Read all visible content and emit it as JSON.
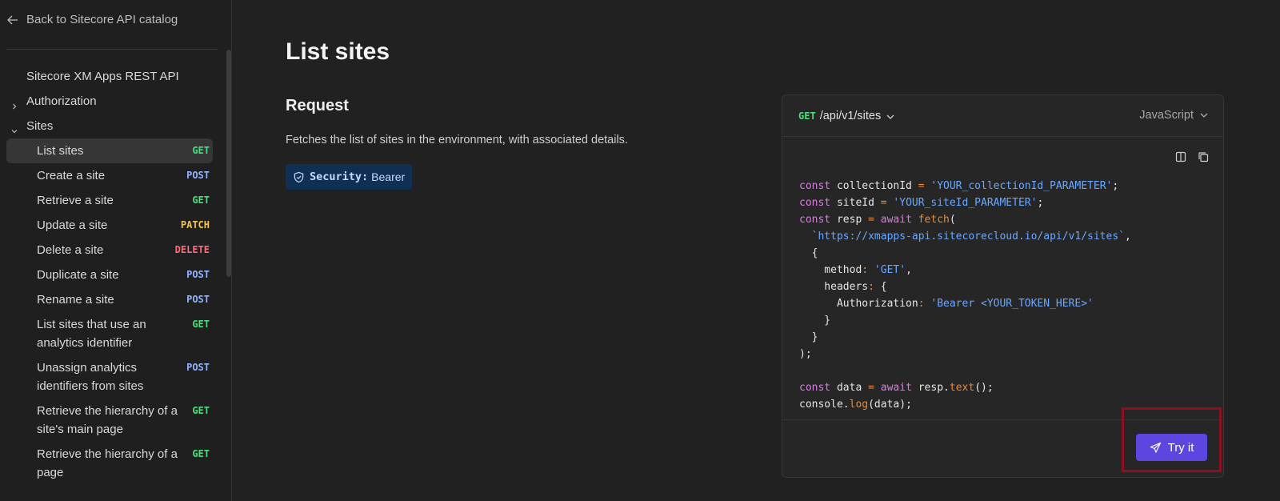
{
  "sidebar": {
    "back_label": "Back to Sitecore API catalog",
    "items": [
      {
        "label": "Sitecore XM Apps REST API",
        "level": 0,
        "expander": "none"
      },
      {
        "label": "Authorization",
        "level": 0,
        "expander": "collapsed"
      },
      {
        "label": "Sites",
        "level": 0,
        "expander": "expanded"
      },
      {
        "label": "List sites",
        "level": 1,
        "method": "GET",
        "active": true
      },
      {
        "label": "Create a site",
        "level": 1,
        "method": "POST"
      },
      {
        "label": "Retrieve a site",
        "level": 1,
        "method": "GET"
      },
      {
        "label": "Update a site",
        "level": 1,
        "method": "PATCH"
      },
      {
        "label": "Delete a site",
        "level": 1,
        "method": "DELETE"
      },
      {
        "label": "Duplicate a site",
        "level": 1,
        "method": "POST"
      },
      {
        "label": "Rename a site",
        "level": 1,
        "method": "POST"
      },
      {
        "label": "List sites that use an analytics identifier",
        "level": 1,
        "method": "GET"
      },
      {
        "label": "Unassign analytics identifiers from sites",
        "level": 1,
        "method": "POST"
      },
      {
        "label": "Retrieve the hierarchy of a site's main page",
        "level": 1,
        "method": "GET"
      },
      {
        "label": "Retrieve the hierarchy of a page",
        "level": 1,
        "method": "GET"
      }
    ]
  },
  "main": {
    "title": "List sites",
    "section": "Request",
    "description": "Fetches the list of sites in the environment, with associated details.",
    "security": {
      "label": "Security:",
      "value": "Bearer",
      "icon": "shield-icon"
    }
  },
  "code_panel": {
    "method": "GET",
    "path": "/api/v1/sites",
    "language": "JavaScript",
    "try_label": "Try it",
    "lines": [
      [
        [
          "kw",
          "const"
        ],
        [
          "prop",
          " collectionId "
        ],
        [
          "op",
          "="
        ],
        [
          "str",
          " 'YOUR_collectionId_PARAMETER'"
        ],
        [
          "prop",
          ";"
        ]
      ],
      [
        [
          "kw",
          "const"
        ],
        [
          "prop",
          " siteId "
        ],
        [
          "op",
          "="
        ],
        [
          "str",
          " 'YOUR_siteId_PARAMETER'"
        ],
        [
          "prop",
          ";"
        ]
      ],
      [
        [
          "kw",
          "const"
        ],
        [
          "prop",
          " resp "
        ],
        [
          "op",
          "="
        ],
        [
          "kw",
          " await"
        ],
        [
          "fn",
          " fetch"
        ],
        [
          "prop",
          "("
        ]
      ],
      [
        [
          "str",
          "  `https://xmapps-api.sitecorecloud.io/api/v1/sites`"
        ],
        [
          "prop",
          ","
        ]
      ],
      [
        [
          "prop",
          "  {"
        ]
      ],
      [
        [
          "prop",
          "    method"
        ],
        [
          "op",
          ":"
        ],
        [
          "str",
          " 'GET'"
        ],
        [
          "prop",
          ","
        ]
      ],
      [
        [
          "prop",
          "    headers"
        ],
        [
          "op",
          ":"
        ],
        [
          "prop",
          " {"
        ]
      ],
      [
        [
          "prop",
          "      Authorization"
        ],
        [
          "op",
          ":"
        ],
        [
          "str",
          " 'Bearer <YOUR_TOKEN_HERE>'"
        ]
      ],
      [
        [
          "prop",
          "    }"
        ]
      ],
      [
        [
          "prop",
          "  }"
        ]
      ],
      [
        [
          "prop",
          ");"
        ]
      ],
      [
        [
          "prop",
          ""
        ]
      ],
      [
        [
          "kw",
          "const"
        ],
        [
          "prop",
          " data "
        ],
        [
          "op",
          "="
        ],
        [
          "kw",
          " await"
        ],
        [
          "prop",
          " resp."
        ],
        [
          "fn",
          "text"
        ],
        [
          "prop",
          "();"
        ]
      ],
      [
        [
          "prop",
          "console."
        ],
        [
          "fn",
          "log"
        ],
        [
          "prop",
          "(data);"
        ]
      ]
    ]
  },
  "colors": {
    "get": "#4ade80",
    "post": "#93b4ff",
    "patch": "#f3c44f",
    "delete": "#ff6b7d",
    "accent": "#5b47e0",
    "highlight": "#8c1020"
  }
}
